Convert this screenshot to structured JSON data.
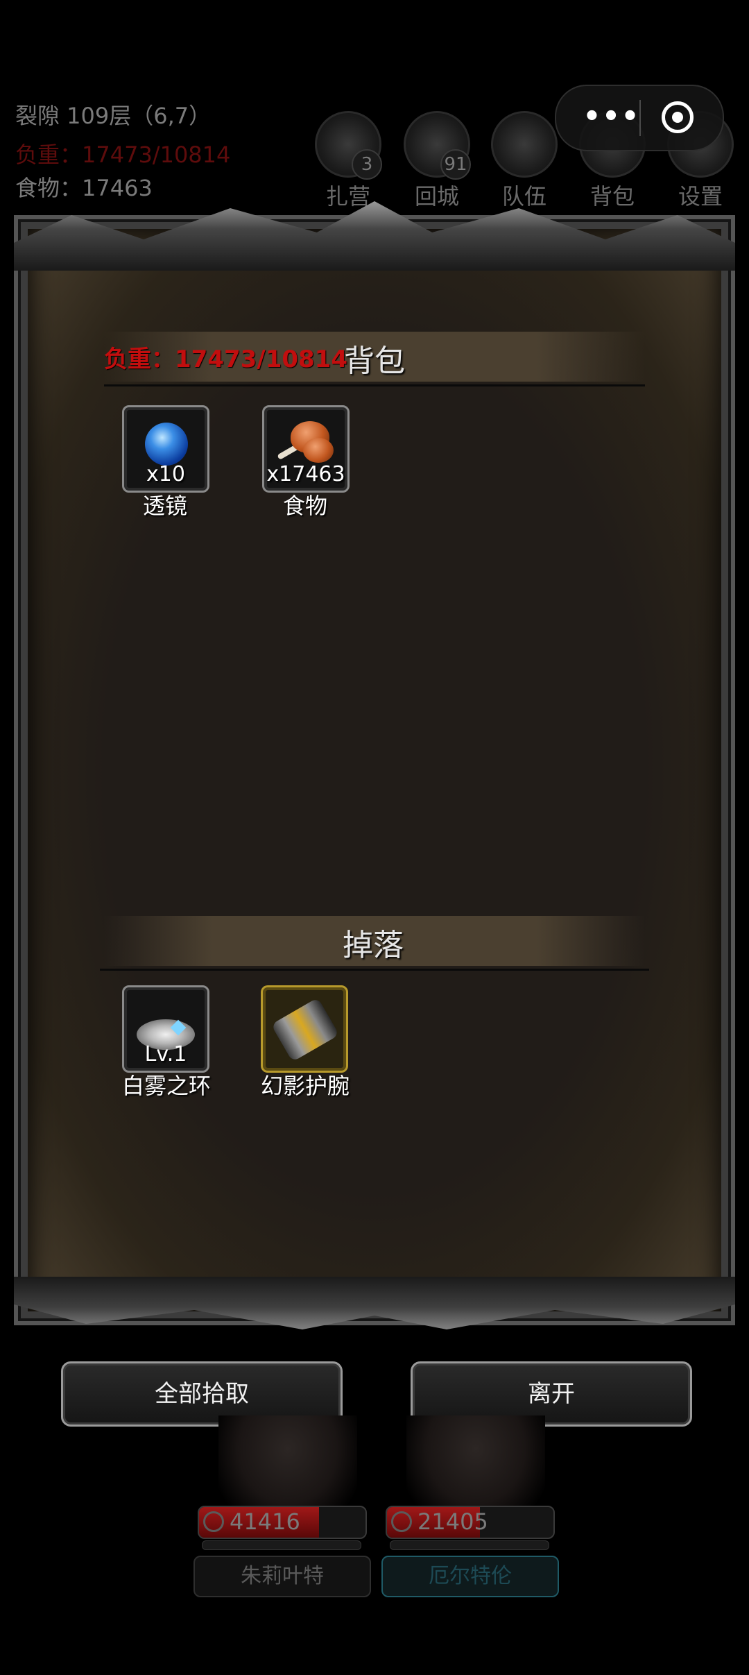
{
  "hud": {
    "location": "裂隙 109层（6,7）",
    "weight_line": "负重：17473/10814",
    "food_line": "食物：17463",
    "buttons": [
      {
        "label": "扎营",
        "icon": "campfire-icon",
        "badge": "3"
      },
      {
        "label": "回城",
        "icon": "portal-icon",
        "badge": "91"
      },
      {
        "label": "队伍",
        "icon": "team-icon",
        "badge": ""
      },
      {
        "label": "背包",
        "icon": "backpack-icon",
        "badge": ""
      },
      {
        "label": "设置",
        "icon": "gear-icon",
        "badge": ""
      }
    ]
  },
  "backpack": {
    "weight": "负重：17473/10814",
    "title": "背包",
    "items": [
      {
        "name": "透镜",
        "qty": "x10",
        "icon": "blue-orb-icon"
      },
      {
        "name": "食物",
        "qty": "x17463",
        "icon": "meat-icon"
      }
    ]
  },
  "drops": {
    "title": "掉落",
    "items": [
      {
        "name": "白雾之环",
        "qty": "Lv.1",
        "icon": "ring-icon"
      },
      {
        "name": "幻影护腕",
        "qty": "",
        "icon": "bracer-icon"
      }
    ]
  },
  "actions": {
    "pickup_all": "全部拾取",
    "leave": "离开"
  },
  "heroes": [
    {
      "name": "朱莉叶特",
      "hp": "41416",
      "hp_fraction": 0.72
    },
    {
      "name": "厄尔特伦",
      "hp": "21405",
      "hp_fraction": 0.56
    }
  ],
  "colors": {
    "warning_red": "#c20e0e",
    "hp_red": "#a01818",
    "gold_frame": "#b79a2c"
  }
}
